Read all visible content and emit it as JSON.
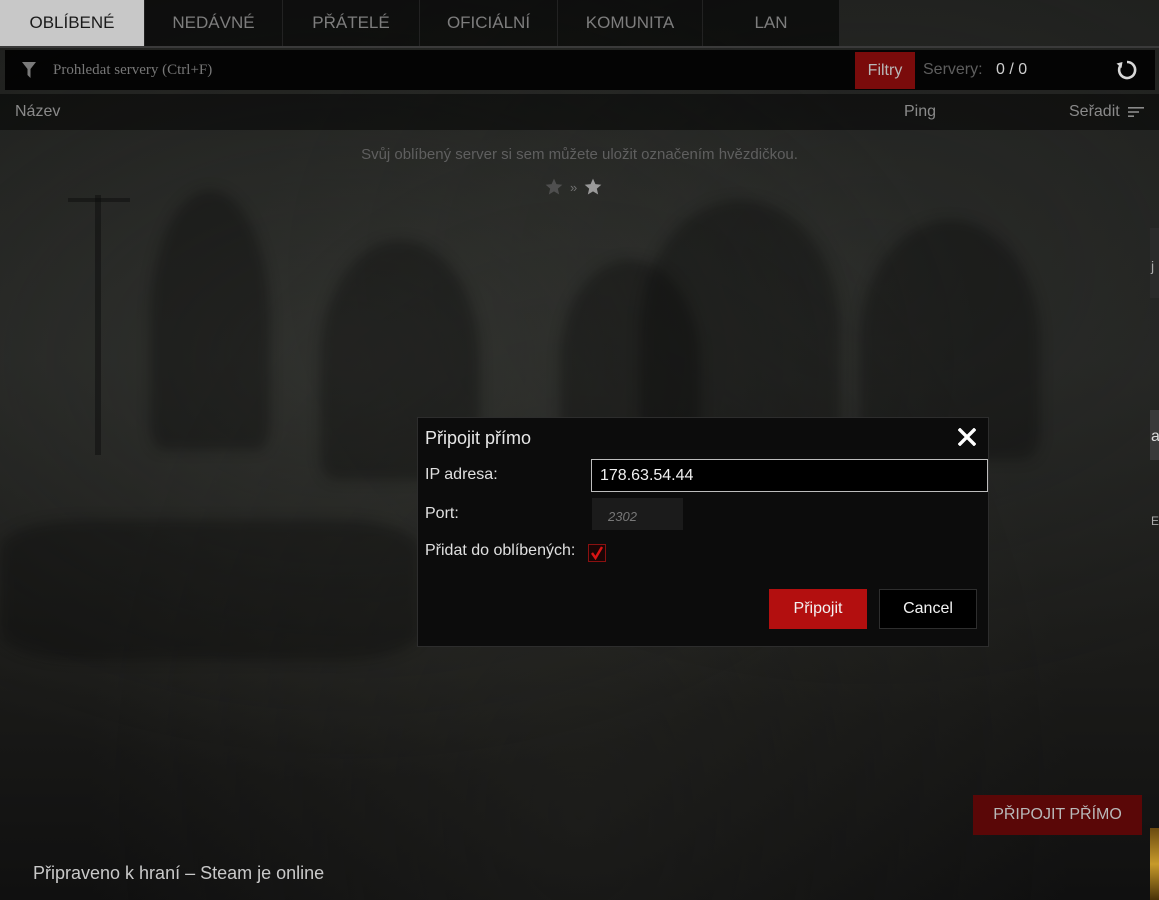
{
  "tabs": [
    {
      "label": "OBLÍBENÉ",
      "active": true
    },
    {
      "label": "NEDÁVNÉ",
      "active": false
    },
    {
      "label": "PŘÁTELÉ",
      "active": false
    },
    {
      "label": "OFICIÁLNÍ",
      "active": false
    },
    {
      "label": "KOMUNITA",
      "active": false
    },
    {
      "label": "LAN",
      "active": false
    }
  ],
  "search": {
    "placeholder": "Prohledat servery (Ctrl+F)",
    "filter_label": "Filtry",
    "servers_label": "Servery:",
    "servers_count": "0 / 0",
    "icon": "funnel-icon",
    "refresh_icon": "refresh-icon"
  },
  "columns": {
    "name": "Název",
    "ping": "Ping",
    "sort": "Seřadit"
  },
  "empty": {
    "message": "Svůj oblíbený server si sem můžete uložit označením hvězdičkou.",
    "separator": "»"
  },
  "dialog": {
    "title": "Připojit přímo",
    "ip_label": "IP adresa:",
    "ip_value": "178.63.54.44",
    "port_label": "Port:",
    "port_placeholder": "2302",
    "favorite_label": "Přidat do oblíbených:",
    "favorite_checked": true,
    "connect_label": "Připojit",
    "cancel_label": "Cancel"
  },
  "footer": {
    "direct_connect_label": "PŘIPOJIT PŘÍMO",
    "status": "Připraveno k hraní – Steam je online"
  },
  "edge_letters": [
    "j",
    "a",
    "E"
  ],
  "colors": {
    "accent_red": "#b30f0f",
    "dark_red": "#7a0b0b",
    "active_tab": "#c8c8c8"
  }
}
